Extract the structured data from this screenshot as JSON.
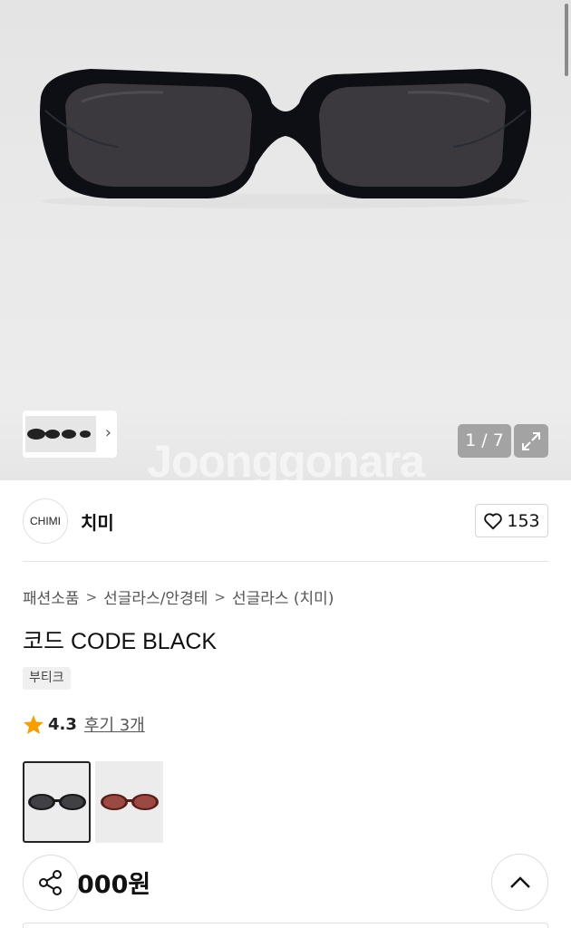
{
  "gallery": {
    "counter": "1 / 7",
    "watermark": "Joonggonara",
    "expand_icon": "expand-icon",
    "thumb_next_icon": "chevron-right-icon"
  },
  "seller": {
    "logo_text": "CHIMI",
    "name": "치미",
    "like_count": "153",
    "like_icon": "heart-outline-icon"
  },
  "breadcrumb": [
    "패션소품",
    "선글라스/안경테",
    "선글라스 (치미)"
  ],
  "product": {
    "title": "코드 CODE BLACK",
    "badge": "부티크",
    "rating": "4.3",
    "review_link": "후기 3개",
    "price_visible": "000원",
    "options": [
      {
        "color": "black",
        "selected": true
      },
      {
        "color": "brown",
        "selected": false
      }
    ]
  },
  "floating": {
    "share_icon": "share-icon",
    "top_icon": "chevron-up-icon"
  }
}
